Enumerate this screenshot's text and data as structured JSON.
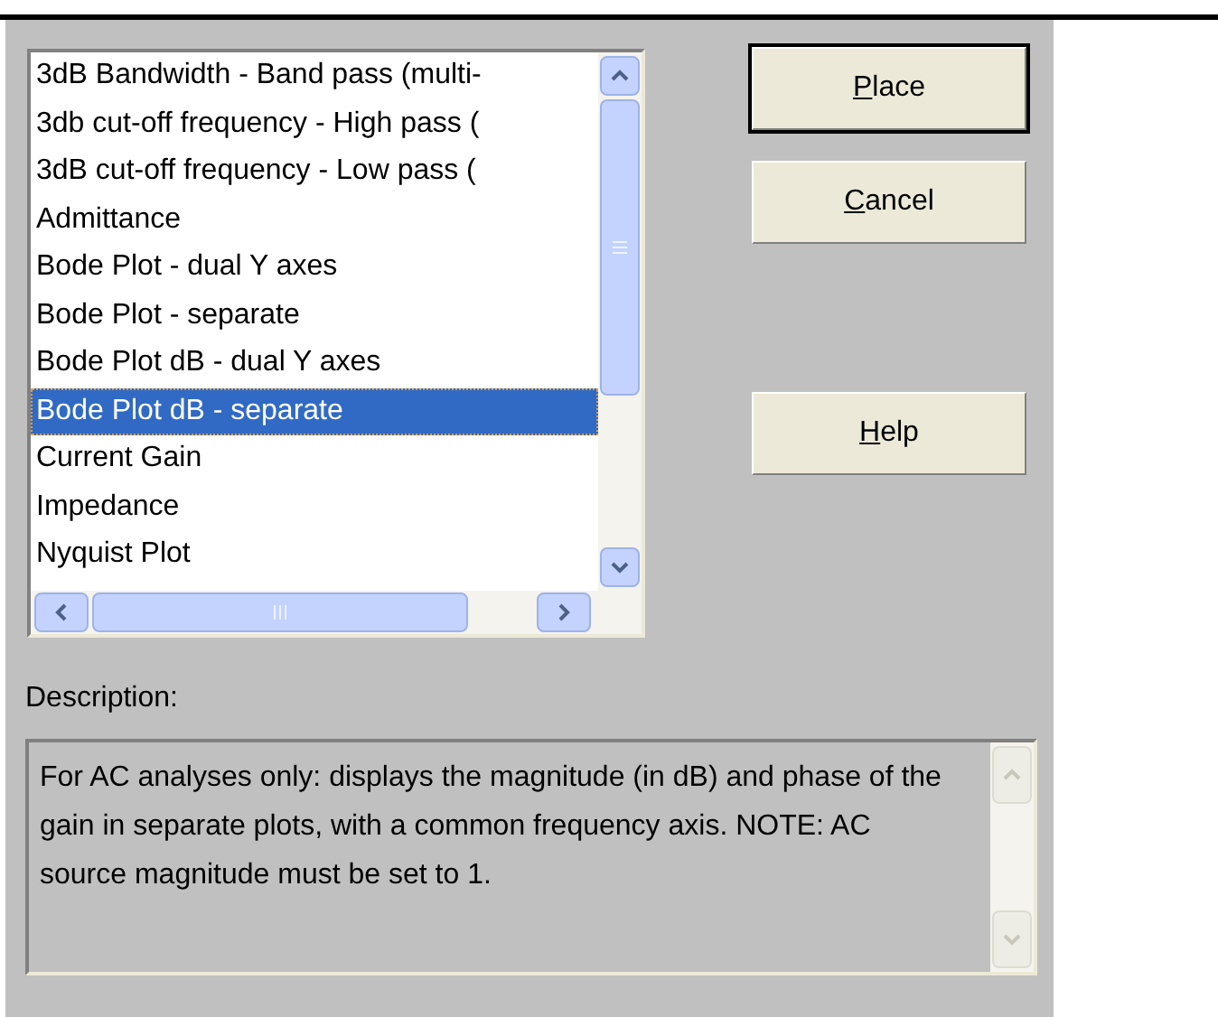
{
  "list": {
    "items": [
      {
        "label": "3dB Bandwidth - Band pass (multi-",
        "selected": false
      },
      {
        "label": "3db cut-off frequency - High pass (",
        "selected": false
      },
      {
        "label": "3dB cut-off frequency - Low pass (",
        "selected": false
      },
      {
        "label": "Admittance",
        "selected": false
      },
      {
        "label": "Bode Plot - dual Y axes",
        "selected": false
      },
      {
        "label": "Bode Plot - separate",
        "selected": false
      },
      {
        "label": "Bode Plot dB - dual Y axes",
        "selected": false
      },
      {
        "label": "Bode Plot dB - separate",
        "selected": true
      },
      {
        "label": "Current Gain",
        "selected": false
      },
      {
        "label": "Impedance",
        "selected": false
      },
      {
        "label": "Nyquist Plot",
        "selected": false
      }
    ]
  },
  "buttons": [
    {
      "label": "Place",
      "default": true
    },
    {
      "label": "Cancel",
      "default": false
    },
    {
      "label": "Help",
      "default": false
    }
  ],
  "description": {
    "label": "Description:",
    "text": "For AC analyses only: displays the magnitude (in dB) and phase of the gain in separate plots, with a common frequency axis.  NOTE: AC source magnitude must be set to 1."
  }
}
